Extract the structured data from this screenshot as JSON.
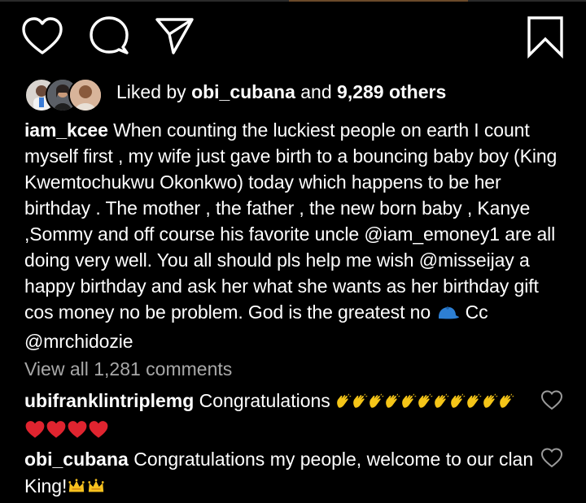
{
  "actions": {
    "like": "heart-outline-icon",
    "comment": "comment-bubble-icon",
    "share": "paper-plane-icon",
    "save": "bookmark-icon"
  },
  "likes": {
    "prefix": "Liked by ",
    "user": "obi_cubana",
    "middle": " and ",
    "count": "9,289 others"
  },
  "caption": {
    "username": "iam_kcee",
    "text": " When counting the luckiest people on earth I count myself first , my wife just gave birth to a bouncing baby boy (King Kwemtochukwu Okonkwo)  today which happens to be her birthday . The mother , the father , the new born baby , Kanye ,Sommy and off course his favorite uncle @iam_emoney1 are all doing very well. You all should  pls help me wish @misseijay  a happy birthday and ask her what she wants as her birthday gift cos money no be problem. God is the greatest no ",
    "emoji": "cap-emoji",
    "tail": " Cc @mrchidozie"
  },
  "view_all": "View all 1,281 comments",
  "comments": [
    {
      "username": "ubifranklintriplemg",
      "text": " Congratulations ",
      "emoji_clap_count": 11,
      "emoji_heart_count": 4
    },
    {
      "username": "obi_cubana",
      "text": " Congratulations my people, welcome to our clan King!",
      "emoji_crown_count": 2
    }
  ],
  "colors": {
    "background": "#000000",
    "text": "#ffffff",
    "muted": "#a8a8a8",
    "heart_red": "#e0242f",
    "clap_yellow": "#f5c518",
    "crown_gold": "#f7c21f"
  }
}
